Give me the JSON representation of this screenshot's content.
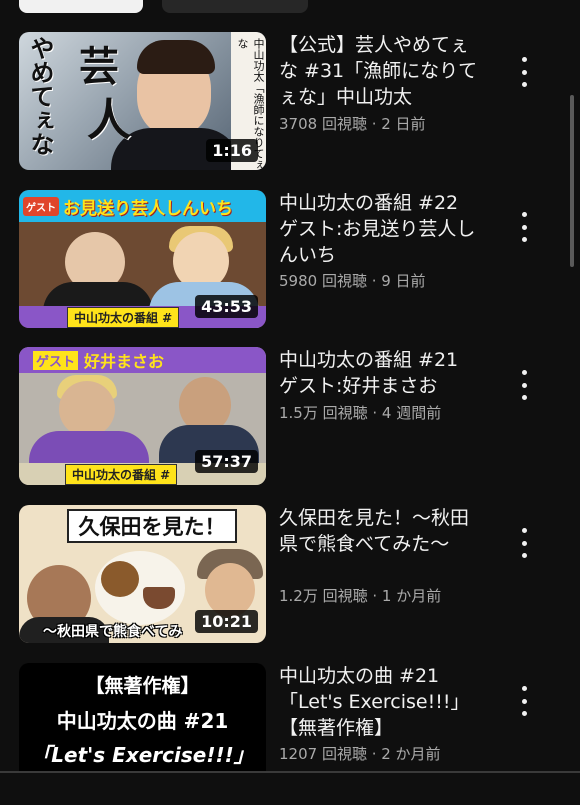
{
  "videos": [
    {
      "title": "【公式】芸人やめてぇな #31「漁師になりてぇな」中山功太",
      "meta": "3708 回視聴 · 2 日前",
      "duration": "1:16",
      "thumb": {
        "big1": "芸",
        "big2": "人",
        "side": "やめてぇな",
        "vbox": "中山功太「漁師になりてぇな"
      }
    },
    {
      "title": "中山功太の番組 #22 ゲスト:お見送り芸人しんいち",
      "meta": "5980 回視聴 · 9 日前",
      "duration": "43:53",
      "thumb": {
        "guest_tag": "ゲスト",
        "banner": "お見送り芸人しんいち",
        "lowbar": "中山功太の番組 #"
      }
    },
    {
      "title": "中山功太の番組 #21 ゲスト:好井まさお",
      "meta": "1.5万 回視聴 · 4 週間前",
      "duration": "57:37",
      "thumb": {
        "guest_tag": "ゲスト",
        "banner": "好井まさお",
        "lowbar": "中山功太の番組 #"
      }
    },
    {
      "title": "久保田を見た！〜秋田県で熊食べてみた〜",
      "meta": "1.2万 回視聴 · 1 か月前",
      "duration": "10:21",
      "thumb": {
        "box": "久保田を見た！",
        "sub": "〜秋田県で熊食べてみ"
      }
    },
    {
      "title": "中山功太の曲 #21「Let's Exercise!!!」【無著作権】",
      "meta": "1207 回視聴 · 2 か月前",
      "duration": "",
      "thumb": {
        "l1": "【無著作権】",
        "l2": "中山功太の曲 #21",
        "l3": "「Let's Exercise!!!」"
      }
    }
  ],
  "icons": {
    "more": "more-vert-icon"
  },
  "colors": {
    "background": "#0f0f0f",
    "text": "#f1f1f1",
    "meta": "#aaaaaa"
  }
}
